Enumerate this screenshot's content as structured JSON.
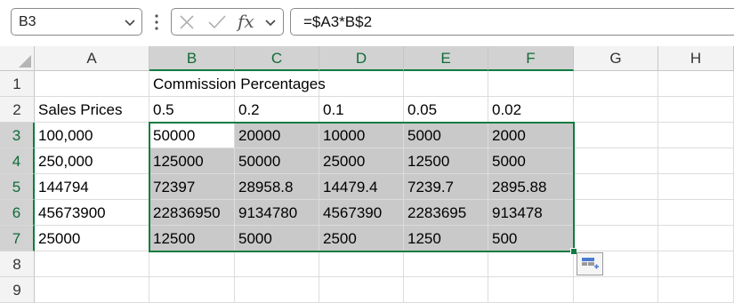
{
  "formula_bar": {
    "name_box": "B3",
    "fx_label": "fx",
    "formula": "=$A3*B$2"
  },
  "columns": [
    "A",
    "B",
    "C",
    "D",
    "E",
    "F",
    "G",
    "H"
  ],
  "rows": [
    "1",
    "2",
    "3",
    "4",
    "5",
    "6",
    "7",
    "8",
    "9"
  ],
  "cells": {
    "B1": "Commission Percentages",
    "A2": "Sales Prices",
    "B2": "0.5",
    "C2": "0.2",
    "D2": "0.1",
    "E2": "0.05",
    "F2": "0.02",
    "A3": "100,000",
    "B3": "50000",
    "C3": "20000",
    "D3": "10000",
    "E3": "5000",
    "F3": "2000",
    "A4": "250,000",
    "B4": "125000",
    "C4": "50000",
    "D4": "25000",
    "E4": "12500",
    "F4": "5000",
    "A5": "144794",
    "B5": "72397",
    "C5": "28958.8",
    "D5": "14479.4",
    "E5": "7239.7",
    "F5": "2895.88",
    "A6": "45673900",
    "B6": "22836950",
    "C6": "9134780",
    "D6": "4567390",
    "E6": "2283695",
    "F6": "913478",
    "A7": "25000",
    "B7": "12500",
    "C7": "5000",
    "D7": "2500",
    "E7": "1250",
    "F7": "500"
  },
  "selection": {
    "active_cell": "B3",
    "range": "B3:F7"
  },
  "colors": {
    "accent": "#107c41",
    "selection_fill": "#c9c9c9"
  },
  "icons": [
    "chevron-down-icon",
    "more-options-icon",
    "cancel-icon",
    "enter-icon",
    "insert-function-icon",
    "quick-analysis-icon",
    "select-all-icon"
  ]
}
